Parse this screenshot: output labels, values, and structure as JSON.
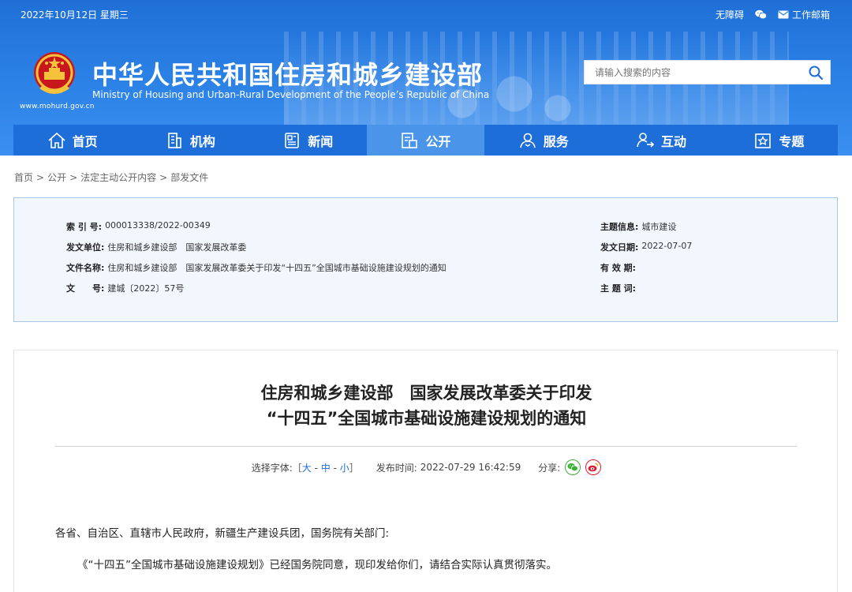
{
  "header": {
    "date": "2022年10月12日 星期三",
    "links": [
      "无障碍",
      "",
      "工作邮箱"
    ],
    "title": "中华人民共和国住房和城乡建设部",
    "subtitle": "Ministry of Housing and Urban-Rural Development of the People’s Republic of China",
    "url": "www.mohurd.gov.cn",
    "search_placeholder": "请输入搜索的内容"
  },
  "nav": [
    {
      "label": "首页",
      "icon": "home-icon"
    },
    {
      "label": "机构",
      "icon": "building-icon"
    },
    {
      "label": "新闻",
      "icon": "news-icon"
    },
    {
      "label": "公开",
      "icon": "open-icon",
      "active": true
    },
    {
      "label": "服务",
      "icon": "service-icon"
    },
    {
      "label": "互动",
      "icon": "interact-icon"
    },
    {
      "label": "专题",
      "icon": "topic-icon"
    }
  ],
  "breadcrumb": [
    "首页",
    "公开",
    "法定主动公开内容",
    "部发文件"
  ],
  "info": {
    "index_label": "索 引 号:",
    "index_value": "000013338/2022-00349",
    "issuer_label": "发文单位:",
    "issuer_value": "住房和城乡建设部　国家发展改革委",
    "docname_label": "文件名称:",
    "docname_value": "住房和城乡建设部　国家发展改革委关于印发“十四五”全国城市基础设施建设规划的通知",
    "docno_label": "文　　号:",
    "docno_value": "建城〔2022〕57号",
    "topic_label": "主题信息:",
    "topic_value": "城市建设",
    "date_label": "发文日期:",
    "date_value": "2022-07-07",
    "valid_label": "有 效 期:",
    "valid_value": "",
    "subject_label": "主 题 词:",
    "subject_value": ""
  },
  "article": {
    "title_line1": "住房和城乡建设部　国家发展改革委关于印发",
    "title_line2": "“十四五”全国城市基础设施建设规划的通知",
    "font_label": "选择字体:［",
    "font_large": "大",
    "font_medium": "中",
    "font_small": "小",
    "font_close": "］",
    "publish_label": "发布时间:",
    "publish_time": "2022-07-29 16:42:59",
    "share_label": "分享:",
    "para1": "各省、自治区、直辖市人民政府，新疆生产建设兵团，国务院有关部门:",
    "para2": "《“十四五”全国城市基础设施建设规划》已经国务院同意，现印发给你们，请结合实际认真贯彻落实。"
  },
  "colors": {
    "header_blue": "#2a7fe4",
    "nav_blue": "#1d6ed9",
    "nav_active": "#4a94ea",
    "info_bg": "#f2f7fd",
    "info_border": "#a7c6ea"
  }
}
